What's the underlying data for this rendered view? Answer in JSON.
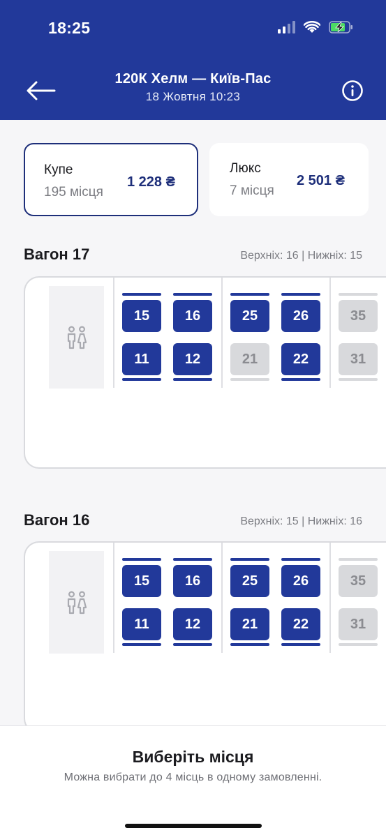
{
  "status_bar": {
    "time": "18:25"
  },
  "header": {
    "title": "120К Хелм — Київ-Пас",
    "subtitle": "18 Жовтня 10:23"
  },
  "classes": [
    {
      "name": "Купе",
      "count": "195 місця",
      "price": "1 228 ₴",
      "selected": true
    },
    {
      "name": "Люкс",
      "count": "7 місця",
      "price": "2 501 ₴",
      "selected": false
    }
  ],
  "wagons": [
    {
      "title": "Вагон 17",
      "stats": "Верхніх: 16 | Нижніх: 15",
      "compartments": [
        {
          "upper": [
            {
              "num": "15",
              "free": true
            },
            {
              "num": "16",
              "free": true
            }
          ],
          "lower": [
            {
              "num": "11",
              "free": true
            },
            {
              "num": "12",
              "free": true
            }
          ]
        },
        {
          "upper": [
            {
              "num": "25",
              "free": true
            },
            {
              "num": "26",
              "free": true
            }
          ],
          "lower": [
            {
              "num": "21",
              "free": false
            },
            {
              "num": "22",
              "free": true
            }
          ]
        },
        {
          "upper": [
            {
              "num": "35",
              "free": false
            }
          ],
          "lower": [
            {
              "num": "31",
              "free": false
            }
          ]
        }
      ]
    },
    {
      "title": "Вагон 16",
      "stats": "Верхніх: 15 | Нижніх: 16",
      "compartments": [
        {
          "upper": [
            {
              "num": "15",
              "free": true
            },
            {
              "num": "16",
              "free": true
            }
          ],
          "lower": [
            {
              "num": "11",
              "free": true
            },
            {
              "num": "12",
              "free": true
            }
          ]
        },
        {
          "upper": [
            {
              "num": "25",
              "free": true
            },
            {
              "num": "26",
              "free": true
            }
          ],
          "lower": [
            {
              "num": "21",
              "free": true
            },
            {
              "num": "22",
              "free": true
            }
          ]
        },
        {
          "upper": [
            {
              "num": "35",
              "free": false
            }
          ],
          "lower": [
            {
              "num": "31",
              "free": false
            }
          ]
        }
      ]
    }
  ],
  "bottom": {
    "title": "Виберіть місця",
    "subtitle": "Можна вибрати до 4 місць в одному замовленні."
  },
  "icons": {
    "back": "arrow-left-icon",
    "info": "info-icon",
    "toilet": "restroom-icon",
    "wifi": "wifi-icon",
    "battery": "battery-charging-icon",
    "signal": "signal-icon"
  },
  "colors": {
    "brand": "#22399a",
    "seat_taken": "#d8d9dc",
    "battery": "#4cd964"
  }
}
